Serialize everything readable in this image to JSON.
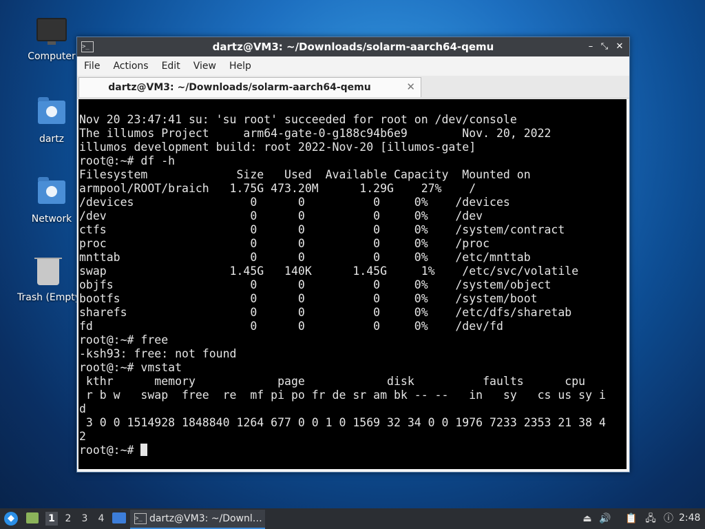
{
  "desktop": {
    "icons": [
      {
        "label": "Computer"
      },
      {
        "label": "dartz"
      },
      {
        "label": "Network"
      },
      {
        "label": "Trash (Empty)"
      }
    ]
  },
  "window": {
    "title": "dartz@VM3: ~/Downloads/solarm-aarch64-qemu",
    "controls": {
      "minimize": "–",
      "maximize": "⤡",
      "close": "✕"
    },
    "menu": [
      "File",
      "Actions",
      "Edit",
      "View",
      "Help"
    ],
    "tab": {
      "label": "dartz@VM3: ~/Downloads/solarm-aarch64-qemu",
      "close": "✕"
    }
  },
  "terminal": {
    "lines": [
      "Nov 20 23:47:41 su: 'su root' succeeded for root on /dev/console",
      "The illumos Project     arm64-gate-0-g188c94b6e9        Nov. 20, 2022",
      "illumos development build: root 2022-Nov-20 [illumos-gate]",
      "root@:~# df -h",
      "Filesystem             Size   Used  Available Capacity  Mounted on",
      "armpool/ROOT/braich   1.75G 473.20M      1.29G    27%    /",
      "/devices                 0      0          0     0%    /devices",
      "/dev                     0      0          0     0%    /dev",
      "ctfs                     0      0          0     0%    /system/contract",
      "proc                     0      0          0     0%    /proc",
      "mnttab                   0      0          0     0%    /etc/mnttab",
      "swap                  1.45G   140K      1.45G     1%    /etc/svc/volatile",
      "objfs                    0      0          0     0%    /system/object",
      "bootfs                   0      0          0     0%    /system/boot",
      "sharefs                  0      0          0     0%    /etc/dfs/sharetab",
      "fd                       0      0          0     0%    /dev/fd",
      "root@:~# free",
      "-ksh93: free: not found",
      "root@:~# vmstat",
      " kthr      memory            page            disk          faults      cpu",
      " r b w   swap  free  re  mf pi po fr de sr am bk -- --   in   sy   cs us sy i",
      "d",
      " 3 0 0 1514928 1848840 1264 677 0 0 1 0 1569 32 34 0 0 1976 7233 2353 21 38 4",
      "2"
    ],
    "prompt": "root@:~# "
  },
  "taskbar": {
    "workspaces": [
      "1",
      "2",
      "3",
      "4"
    ],
    "active_workspace": "1",
    "task_label": "dartz@VM3: ~/Downl…",
    "clock": "2:48"
  }
}
